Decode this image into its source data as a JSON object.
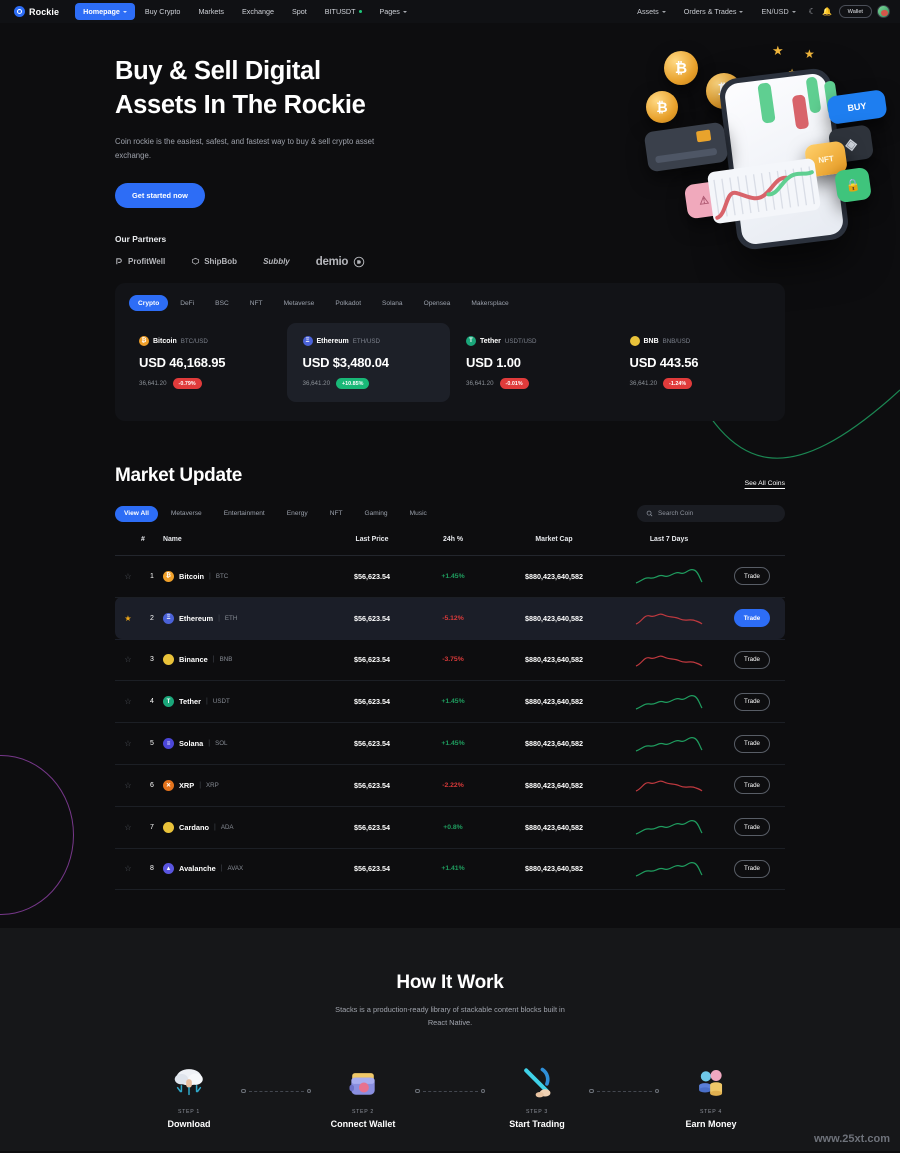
{
  "brand": {
    "name": "Rockie"
  },
  "nav": {
    "links": [
      {
        "label": "Homepage",
        "caret": true,
        "active": true
      },
      {
        "label": "Buy Crypto",
        "caret": false,
        "active": false
      },
      {
        "label": "Markets",
        "caret": false,
        "active": false
      },
      {
        "label": "Exchange",
        "caret": false,
        "active": false
      },
      {
        "label": "Spot",
        "caret": false,
        "active": false
      },
      {
        "label": "BITUSDT",
        "caret": false,
        "active": false,
        "dot": true
      },
      {
        "label": "Pages",
        "caret": true,
        "active": false
      }
    ],
    "right": [
      {
        "label": "Assets",
        "caret": true
      },
      {
        "label": "Orders & Trades",
        "caret": true
      },
      {
        "label": "EN/USD",
        "caret": true
      }
    ],
    "theme_icon": "moon-icon",
    "bell_icon": "bell-icon",
    "wallet_label": "Wallet",
    "avatar_name": "user-avatar"
  },
  "hero": {
    "title_line1": "Buy & Sell Digital",
    "title_line2": "Assets In The Rockie",
    "subtitle": "Coin rockie is the easiest, safest, and fastest way to buy & sell crypto asset exchange.",
    "cta": "Get started now",
    "partners_title": "Our Partners",
    "partners": [
      {
        "name": "ProfitWell"
      },
      {
        "name": "ShipBob"
      },
      {
        "name": "Subbly"
      },
      {
        "name": "demio"
      }
    ],
    "art": {
      "buy_label": "BUY",
      "nft_label": "NFT"
    }
  },
  "ticker": {
    "chips": [
      "Crypto",
      "DeFi",
      "BSC",
      "NFT",
      "Metaverse",
      "Polkadot",
      "Solana",
      "Opensea",
      "Makersplace"
    ],
    "active_chip": "Crypto",
    "cards": [
      {
        "name": "Bitcoin",
        "pair": "BTC/USD",
        "price": "USD 46,168.95",
        "volume": "36,641.20",
        "change": "-0.79%",
        "dir": "down",
        "color": "#f0a02a",
        "glyph": "₿",
        "selected": false
      },
      {
        "name": "Ethereum",
        "pair": "ETH/USD",
        "price": "USD $3,480.04",
        "volume": "36,641.20",
        "change": "+10.85%",
        "dir": "up",
        "color": "#4b62d8",
        "glyph": "Ξ",
        "selected": true
      },
      {
        "name": "Tether",
        "pair": "USDT/USD",
        "price": "USD 1.00",
        "volume": "36,641.20",
        "change": "-0.01%",
        "dir": "down",
        "color": "#1aa67a",
        "glyph": "T",
        "selected": false
      },
      {
        "name": "BNB",
        "pair": "BNB/USD",
        "price": "USD 443.56",
        "volume": "36,641.20",
        "change": "-1.24%",
        "dir": "down",
        "color": "#e9c23a",
        "glyph": "",
        "selected": false
      }
    ]
  },
  "market": {
    "title": "Market Update",
    "see_all": "See All Coins",
    "chips": [
      "View All",
      "Metaverse",
      "Entertainment",
      "Energy",
      "NFT",
      "Gaming",
      "Music"
    ],
    "active_chip": "View All",
    "search_placeholder": "Search Coin",
    "search_value": "",
    "columns": [
      "#",
      "Name",
      "Last Price",
      "24h %",
      "Market Cap",
      "Last 7 Days"
    ],
    "trade_label": "Trade",
    "rows": [
      {
        "rank": "1",
        "star": false,
        "name": "Bitcoin",
        "symbol": "BTC",
        "color": "#f0a02a",
        "glyph": "₿",
        "price": "$56,623.54",
        "pct": "+1.45%",
        "dir": "up",
        "cap": "$880,423,640,582",
        "selected": false
      },
      {
        "rank": "2",
        "star": true,
        "name": "Ethereum",
        "symbol": "ETH",
        "color": "#4b62d8",
        "glyph": "Ξ",
        "price": "$56,623.54",
        "pct": "-5.12%",
        "dir": "down",
        "cap": "$880,423,640,582",
        "selected": true
      },
      {
        "rank": "3",
        "star": false,
        "name": "Binance",
        "symbol": "BNB",
        "color": "#e9c23a",
        "glyph": "",
        "price": "$56,623.54",
        "pct": "-3.75%",
        "dir": "down",
        "cap": "$880,423,640,582",
        "selected": false
      },
      {
        "rank": "4",
        "star": false,
        "name": "Tether",
        "symbol": "USDT",
        "color": "#1aa67a",
        "glyph": "T",
        "price": "$56,623.54",
        "pct": "+1.45%",
        "dir": "up",
        "cap": "$880,423,640,582",
        "selected": false
      },
      {
        "rank": "5",
        "star": false,
        "name": "Solana",
        "symbol": "SOL",
        "color": "#4b46d8",
        "glyph": "≡",
        "price": "$56,623.54",
        "pct": "+1.45%",
        "dir": "up",
        "cap": "$880,423,640,582",
        "selected": false
      },
      {
        "rank": "6",
        "star": false,
        "name": "XRP",
        "symbol": "XRP",
        "color": "#e2721c",
        "glyph": "✕",
        "price": "$56,623.54",
        "pct": "-2.22%",
        "dir": "down",
        "cap": "$880,423,640,582",
        "selected": false
      },
      {
        "rank": "7",
        "star": false,
        "name": "Cardano",
        "symbol": "ADA",
        "color": "#e9c23a",
        "glyph": "",
        "price": "$56,623.54",
        "pct": "+0.8%",
        "dir": "up",
        "cap": "$880,423,640,582",
        "selected": false
      },
      {
        "rank": "8",
        "star": false,
        "name": "Avalanche",
        "symbol": "AVAX",
        "color": "#5a55e0",
        "glyph": "▲",
        "price": "$56,623.54",
        "pct": "+1.41%",
        "dir": "up",
        "cap": "$880,423,640,582",
        "selected": false
      }
    ]
  },
  "how": {
    "title": "How It Work",
    "subtitle": "Stacks is a production-ready library of stackable content blocks built in React Native.",
    "steps": [
      {
        "no": "STEP 1",
        "label": "Download",
        "icon": "cloud-download-icon"
      },
      {
        "no": "STEP 2",
        "label": "Connect Wallet",
        "icon": "wallet-icon"
      },
      {
        "no": "STEP 3",
        "label": "Start Trading",
        "icon": "pickaxe-icon"
      },
      {
        "no": "STEP 4",
        "label": "Earn Money",
        "icon": "coins-icon"
      }
    ]
  },
  "watermark": "www.25xt.com",
  "colors": {
    "accent": "#2d6df6",
    "up": "#19b877",
    "down": "#e03b3b",
    "bg": "#0d0d0f",
    "panel": "#121317"
  }
}
